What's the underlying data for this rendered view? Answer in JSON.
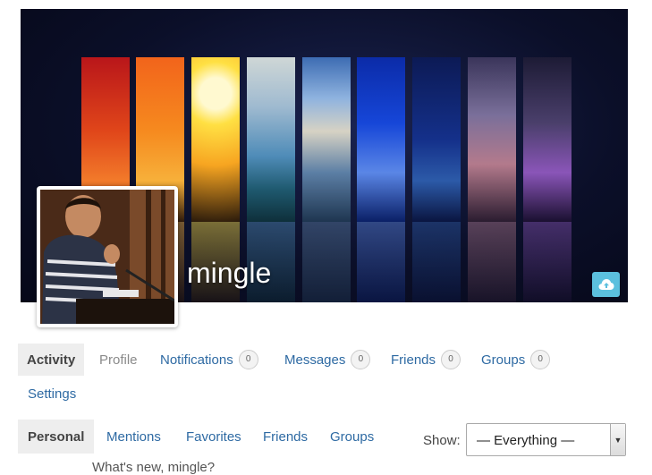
{
  "profile": {
    "username": "mingle"
  },
  "cover": {
    "upload_icon": "cloud-upload-icon",
    "accent_color": "#5bc0de"
  },
  "main_nav": [
    {
      "label": "Activity",
      "count": null,
      "state": "current"
    },
    {
      "label": "Profile",
      "count": null,
      "state": "muted"
    },
    {
      "label": "Notifications",
      "count": "0",
      "state": "link"
    },
    {
      "label": "Messages",
      "count": "0",
      "state": "link"
    },
    {
      "label": "Friends",
      "count": "0",
      "state": "link"
    },
    {
      "label": "Groups",
      "count": "0",
      "state": "link"
    },
    {
      "label": "Settings",
      "count": null,
      "state": "link"
    }
  ],
  "sub_nav": [
    {
      "label": "Personal",
      "state": "current"
    },
    {
      "label": "Mentions",
      "state": "link"
    },
    {
      "label": "Favorites",
      "state": "link"
    },
    {
      "label": "Friends",
      "state": "link"
    },
    {
      "label": "Groups",
      "state": "link"
    }
  ],
  "filter": {
    "label": "Show:",
    "selected": "— Everything —"
  },
  "status_prompt_partial": "What's new, mingle?"
}
